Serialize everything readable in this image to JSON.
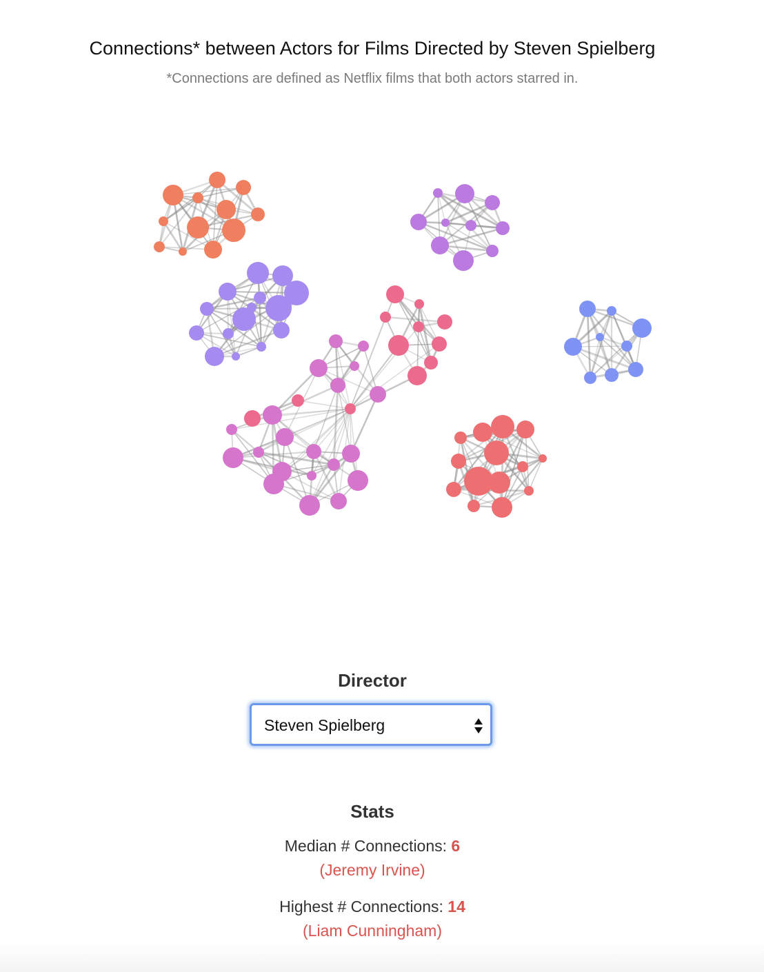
{
  "header": {
    "title": "Connections* between Actors for Films Directed by Steven Spielberg",
    "subtitle": "*Connections are defined as Netflix films that both actors starred in."
  },
  "controls": {
    "director_label": "Director",
    "director_selected": "Steven Spielberg"
  },
  "stats": {
    "heading": "Stats",
    "median_label": "Median # Connections:",
    "median_value": "6",
    "median_actor": "(Jeremy Irvine)",
    "highest_label": "Highest # Connections:",
    "highest_value": "14",
    "highest_actor": "(Liam Cunningham)"
  },
  "colors": {
    "orange": "#ef7f5f",
    "violet": "#bb7ae0",
    "purple": "#a58af0",
    "pink": "#ec6b8d",
    "magenta": "#d675cc",
    "salmon": "#ee6f72",
    "blue": "#7f93f5",
    "edge": "#8a8a8a",
    "accent": "#d9534f"
  },
  "clusters": [
    {
      "color": "orange",
      "nodes": 12
    },
    {
      "color": "violet",
      "nodes": 10
    },
    {
      "color": "purple",
      "nodes": 15
    },
    {
      "color": "blue",
      "nodes": 9
    },
    {
      "color": "pink",
      "nodes": 12
    },
    {
      "color": "magenta",
      "nodes": 19
    },
    {
      "color": "salmon",
      "nodes": 16
    }
  ]
}
